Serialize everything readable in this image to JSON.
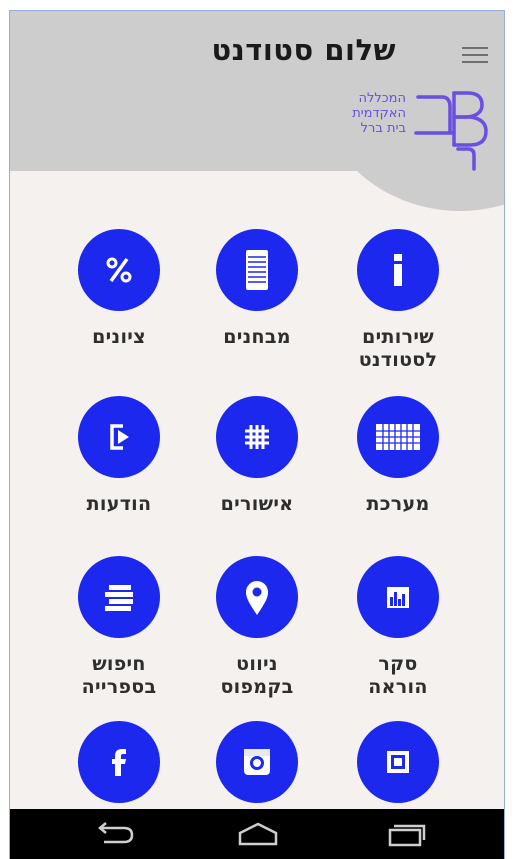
{
  "header": {
    "title": "שלום סטודנט",
    "logo_lines": [
      "המכללה",
      "האקדמית",
      "בית ברל"
    ]
  },
  "tiles": [
    {
      "label": "שירותים לסטודנט",
      "icon": "info-icon"
    },
    {
      "label": "מבחנים",
      "icon": "document-list-icon"
    },
    {
      "label": "ציונים",
      "icon": "percent-icon"
    },
    {
      "label": "מערכת",
      "icon": "timetable-icon"
    },
    {
      "label": "אישורים",
      "icon": "grid-icon"
    },
    {
      "label": "הודעות",
      "icon": "logout-door-icon"
    },
    {
      "label": "סקר הוראה",
      "icon": "bar-chart-icon"
    },
    {
      "label": "ניווט בקמפוס",
      "icon": "location-pin-icon"
    },
    {
      "label": "חיפוש בספרייה",
      "icon": "library-books-icon"
    },
    {
      "label": "",
      "icon": "media-frame-icon"
    },
    {
      "label": "",
      "icon": "instagram-icon"
    },
    {
      "label": "",
      "icon": "facebook-icon"
    }
  ],
  "navbar": {
    "buttons": [
      "back-icon",
      "home-icon",
      "recent-apps-icon"
    ]
  },
  "colors": {
    "accent": "#1c28ee",
    "header_bg": "#cdcdcd",
    "page_bg": "#f4f1ee",
    "logo": "#6a4fe0"
  }
}
